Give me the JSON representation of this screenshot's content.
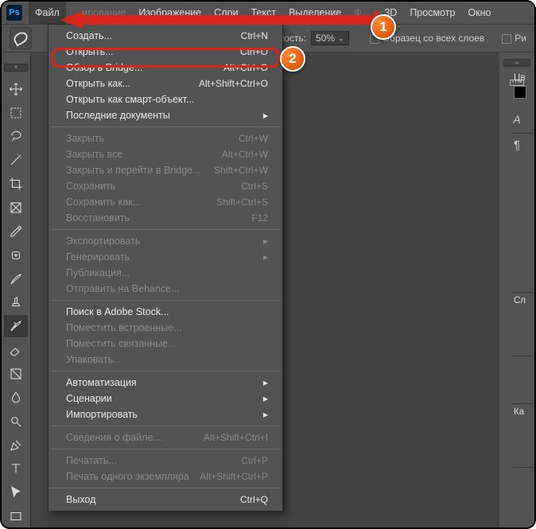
{
  "app": {
    "logo": "Ps"
  },
  "menubar": {
    "items": [
      "Файл",
      "…ирование",
      "Изображение",
      "Слои",
      "Текст",
      "Выделение",
      "Ф…",
      "3D",
      "Просмотр",
      "Окно"
    ]
  },
  "optionsbar": {
    "opacity_label": "…сивность:",
    "opacity_value": "50%",
    "sample_label": "Образец со всех слоев",
    "right_label": "Ри"
  },
  "dropdown": {
    "groups": [
      [
        {
          "label": "Создать...",
          "shortcut": "Ctrl+N",
          "enabled": true
        },
        {
          "label": "Открыть...",
          "shortcut": "Ctrl+O",
          "enabled": true,
          "highlight": true
        },
        {
          "label": "Обзор в Bridge...",
          "shortcut": "Alt+Ctrl+O",
          "enabled": true
        },
        {
          "label": "Открыть как...",
          "shortcut": "Alt+Shift+Ctrl+O",
          "enabled": true
        },
        {
          "label": "Открыть как смарт-объект...",
          "shortcut": "",
          "enabled": true
        },
        {
          "label": "Последние документы",
          "shortcut": "",
          "enabled": true,
          "submenu": true
        }
      ],
      [
        {
          "label": "Закрыть",
          "shortcut": "Ctrl+W",
          "enabled": false
        },
        {
          "label": "Закрыть все",
          "shortcut": "Alt+Ctrl+W",
          "enabled": false
        },
        {
          "label": "Закрыть и перейти в Bridge...",
          "shortcut": "Shift+Ctrl+W",
          "enabled": false
        },
        {
          "label": "Сохранить",
          "shortcut": "Ctrl+S",
          "enabled": false
        },
        {
          "label": "Сохранить как...",
          "shortcut": "Shift+Ctrl+S",
          "enabled": false
        },
        {
          "label": "Восстановить",
          "shortcut": "F12",
          "enabled": false
        }
      ],
      [
        {
          "label": "Экспортировать",
          "shortcut": "",
          "enabled": false,
          "submenu": true
        },
        {
          "label": "Генерировать",
          "shortcut": "",
          "enabled": false,
          "submenu": true
        },
        {
          "label": "Публикация...",
          "shortcut": "",
          "enabled": false
        },
        {
          "label": "Отправить на Behance...",
          "shortcut": "",
          "enabled": false
        }
      ],
      [
        {
          "label": "Поиск в Adobe Stock...",
          "shortcut": "",
          "enabled": true
        },
        {
          "label": "Поместить встроенные...",
          "shortcut": "",
          "enabled": false
        },
        {
          "label": "Поместить связанные...",
          "shortcut": "",
          "enabled": false
        },
        {
          "label": "Упаковать...",
          "shortcut": "",
          "enabled": false
        }
      ],
      [
        {
          "label": "Автоматизация",
          "shortcut": "",
          "enabled": true,
          "submenu": true
        },
        {
          "label": "Сценарии",
          "shortcut": "",
          "enabled": true,
          "submenu": true
        },
        {
          "label": "Импортировать",
          "shortcut": "",
          "enabled": true,
          "submenu": true
        }
      ],
      [
        {
          "label": "Сведения о файле...",
          "shortcut": "Alt+Shift+Ctrl+I",
          "enabled": false
        }
      ],
      [
        {
          "label": "Печатать...",
          "shortcut": "Ctrl+P",
          "enabled": false
        },
        {
          "label": "Печать одного экземпляра",
          "shortcut": "Alt+Shift+Ctrl+P",
          "enabled": false
        }
      ],
      [
        {
          "label": "Выход",
          "shortcut": "Ctrl+Q",
          "enabled": true
        }
      ]
    ]
  },
  "tools": [
    "move",
    "marquee",
    "lasso",
    "magic-wand",
    "crop",
    "frame",
    "eyedropper",
    "healing",
    "brush",
    "clone",
    "history-brush",
    "eraser",
    "gradient",
    "blur",
    "dodge",
    "pen",
    "type",
    "path-select",
    "rectangle"
  ],
  "right_icons": [
    "ruler-icon",
    "character-icon",
    "paragraph-icon"
  ],
  "right_panels": [
    "Цв",
    "",
    "Сл",
    "",
    "Ка"
  ],
  "badges": {
    "one": "1",
    "two": "2"
  }
}
